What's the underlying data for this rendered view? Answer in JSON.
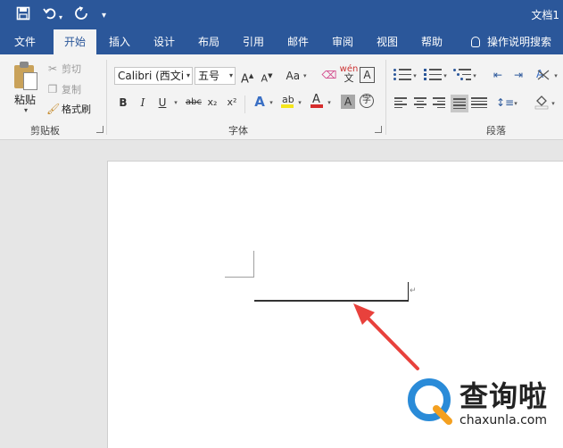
{
  "window": {
    "title": "文档1"
  },
  "quick_access": {
    "save_icon": "save-icon",
    "undo_icon": "undo-icon",
    "redo_icon": "redo-icon",
    "customize_icon": "customize-icon"
  },
  "tabs": [
    {
      "label": "文件",
      "active": false
    },
    {
      "label": "开始",
      "active": true
    },
    {
      "label": "插入",
      "active": false
    },
    {
      "label": "设计",
      "active": false
    },
    {
      "label": "布局",
      "active": false
    },
    {
      "label": "引用",
      "active": false
    },
    {
      "label": "邮件",
      "active": false
    },
    {
      "label": "审阅",
      "active": false
    },
    {
      "label": "视图",
      "active": false
    },
    {
      "label": "帮助",
      "active": false
    }
  ],
  "tell_me": "操作说明搜索",
  "clipboard": {
    "paste_label": "粘贴",
    "cut_label": "剪切",
    "copy_label": "复制",
    "format_painter_label": "格式刷",
    "group_label": "剪贴板"
  },
  "font": {
    "font_name": "Calibri (西文i",
    "font_size": "五号",
    "grow_label": "A",
    "shrink_label": "A",
    "case_label": "Aa",
    "phonetic_label": "wén",
    "bold_label": "B",
    "italic_label": "I",
    "underline_label": "U",
    "strike_label": "abc",
    "subscript_label": "x₂",
    "superscript_label": "x²",
    "group_label": "字体"
  },
  "paragraph": {
    "group_label": "段落"
  },
  "document": {
    "paragraph_mark": "↵"
  },
  "watermark": {
    "brand": "查询啦",
    "url": "chaxunla.com"
  }
}
